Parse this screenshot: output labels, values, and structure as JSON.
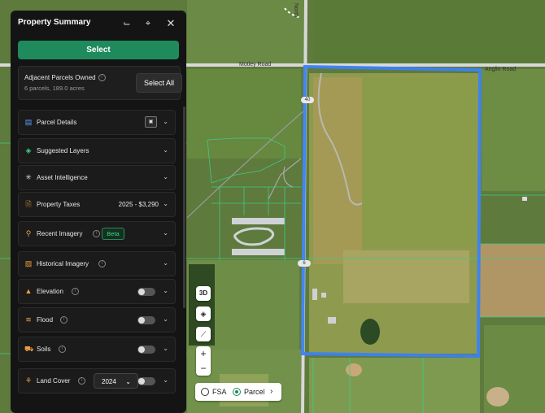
{
  "map": {
    "roads": {
      "motley": "Motley Road",
      "anglin": "Anglin Road",
      "north": "North"
    },
    "shields": [
      "40",
      "6"
    ]
  },
  "panel": {
    "title": "Property Summary",
    "select_label": "Select",
    "adjacent": {
      "title": "Adjacent Parcels Owned",
      "subtitle": "6 parcels, 189.0 acres",
      "select_all": "Select All"
    },
    "rows": [
      {
        "label": "Parcel Details",
        "icon": "parcel-details-icon"
      },
      {
        "label": "Suggested Layers",
        "icon": "layers-icon"
      },
      {
        "label": "Asset Intelligence",
        "icon": "sparkle-icon"
      },
      {
        "label": "Property Taxes",
        "value": "2025 - $3,290",
        "icon": "tax-doc-icon"
      },
      {
        "label": "Recent Imagery",
        "badge": "Beta",
        "icon": "satellite-icon"
      },
      {
        "label": "Historical Imagery",
        "icon": "image-icon"
      },
      {
        "label": "Elevation",
        "icon": "mountain-icon"
      },
      {
        "label": "Flood",
        "icon": "flood-icon"
      },
      {
        "label": "Soils",
        "icon": "tractor-icon"
      },
      {
        "label": "Land Cover",
        "year": "2024",
        "icon": "plant-icon"
      }
    ]
  },
  "controls": {
    "three_d": "3D",
    "zoom_in": "+",
    "zoom_out": "−",
    "fsa": "FSA",
    "parcel": "Parcel"
  },
  "colors": {
    "accent": "#1f8a5c",
    "parcel_outline": "#3b82f6"
  }
}
